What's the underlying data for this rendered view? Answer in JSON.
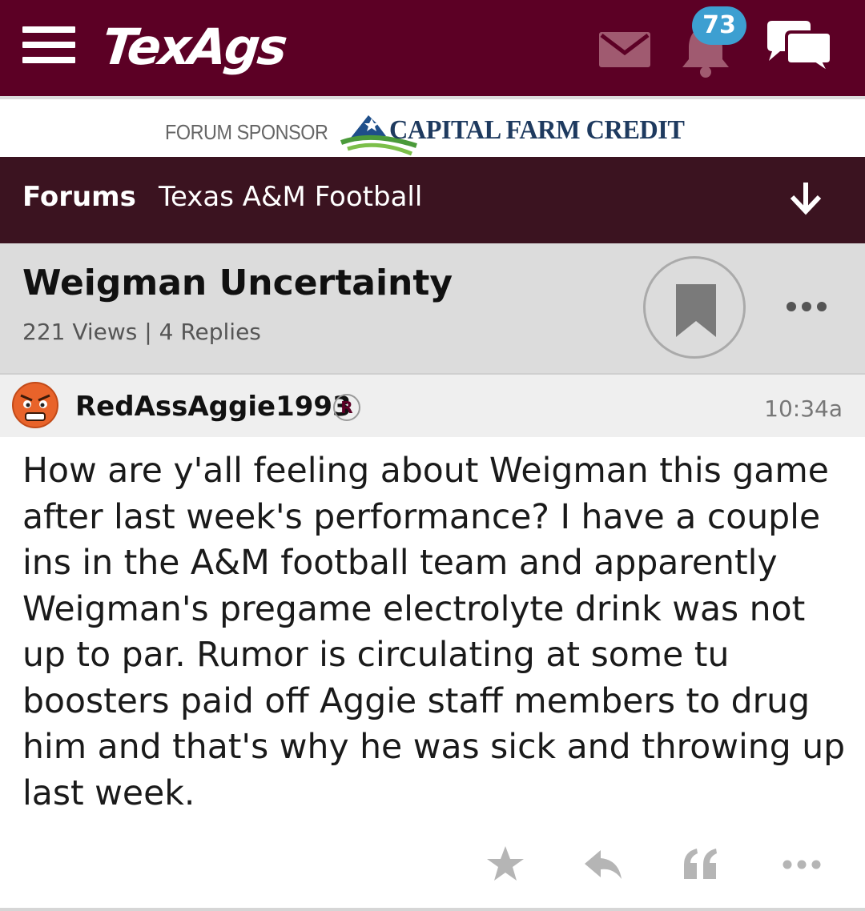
{
  "header": {
    "logo": "TexAgs",
    "notification_count": "73",
    "colors": {
      "brand": "#5c0025",
      "badge": "#3d9fd1"
    },
    "icons": [
      "menu-icon",
      "mail-icon",
      "bell-icon",
      "chat-icon"
    ]
  },
  "sponsor": {
    "label": "FORUM SPONSOR",
    "name": "CAPITAL FARM CREDIT"
  },
  "breadcrumb": {
    "forums": "Forums",
    "board": "Texas A&M Football"
  },
  "thread": {
    "title": "Weigman Uncertainty",
    "meta": "221 Views | 4 Replies"
  },
  "post": {
    "author": "RedAssAggie1993",
    "badge": "R",
    "time": "10:34a",
    "body": "How are y'all feeling about Weigman this game after last week's performance? I have a couple ins in the A&M football team and apparently Weigman's pregame electrolyte drink was not up to par. Rumor is circulating at some tu boosters paid off Aggie staff members to drug him and that's why he was sick and throwing up last week."
  }
}
